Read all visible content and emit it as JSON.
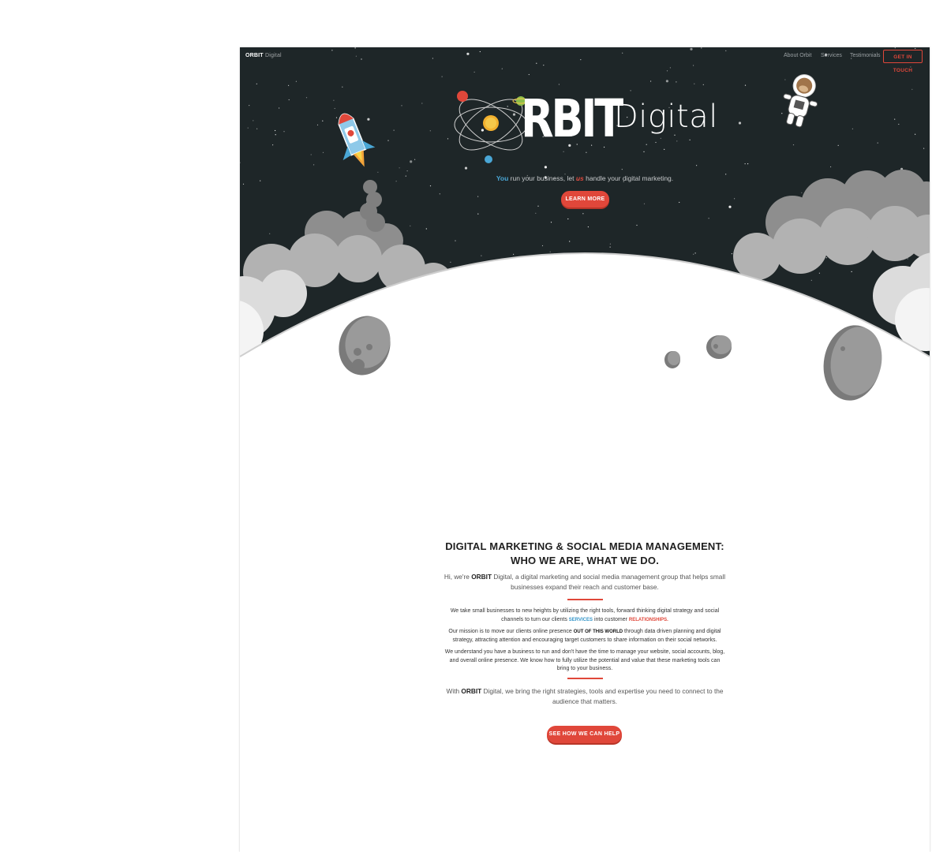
{
  "nav": {
    "brand_bold": "ORBIT",
    "brand_light": "Digital",
    "links": [
      "About Orbit",
      "Services",
      "Testimonials"
    ],
    "cta": "GET IN TOUCH"
  },
  "hero": {
    "logo_word": "RBIT",
    "logo_sub": "Digital",
    "tagline_you": "You",
    "tagline_mid": " run your business, let ",
    "tagline_us": "us",
    "tagline_end": " handle your digital marketing.",
    "button": "LEARN MORE"
  },
  "about": {
    "heading_line1": "DIGITAL MARKETING & SOCIAL MEDIA MANAGEMENT:",
    "heading_line2": "WHO WE ARE, WHAT WE DO.",
    "lead_pre": "Hi, we're ",
    "lead_brand": "ORBIT",
    "lead_post": " Digital, a digital marketing and social media management group that helps small businesses expand their reach and customer base.",
    "p1_pre": "We take small businesses to new heights by utilizing the right tools, forward thinking digital strategy and social channels to turn our clients ",
    "p1_kw1": "SERVICES",
    "p1_mid": " into customer ",
    "p1_kw2": "RELATIONSHIPS.",
    "p2_pre": "Our mission is to move our clients online presence ",
    "p2_kw": "OUT OF THIS WORLD",
    "p2_post": " through data driven planning and digital strategy, attracting attention and encouraging target customers to share information on their social networks.",
    "p3": "We understand you have a business to run and don't have the time to manage your website, social accounts, blog, and overall online presence. We know how to fully utilize the potential and value that these marketing tools can bring to your business.",
    "closing_pre": "With ",
    "closing_brand": "ORBIT",
    "closing_post": " Digital, we bring the right strategies, tools and expertise you need to connect to the audience that matters.",
    "button": "SEE HOW WE CAN HELP"
  },
  "colors": {
    "sky": "#1e2628",
    "accent": "#e0473a",
    "blue": "#4aa7d6",
    "cloud_dark": "#9a9a9a",
    "cloud_light": "#d8d8d8"
  }
}
